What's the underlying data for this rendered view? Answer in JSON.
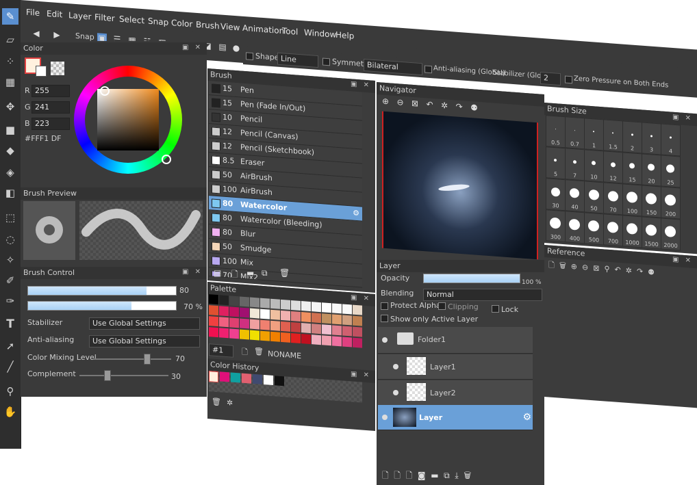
{
  "menu": [
    "File",
    "Edit",
    "Layer",
    "Filter",
    "Select",
    "Snap",
    "Color",
    "Brush",
    "View",
    "Animation",
    "Tool",
    "Window",
    "Help"
  ],
  "toolbar": {
    "snap_label": "Snap"
  },
  "options": {
    "shape_label": "Shape",
    "shape_value": "Line",
    "symmetry_label": "Symmetry",
    "symmetry_value": "Bilateral",
    "antialias_label": "Anti-aliasing (Global)",
    "stabilizer_label": "Stabilizer (Global)",
    "stabilizer_value": "2",
    "zero_pressure_label": "Zero Pressure on Both Ends"
  },
  "color_panel": {
    "title": "Color",
    "r_label": "R",
    "r_value": "255",
    "g_label": "G",
    "g_value": "241",
    "b_label": "B",
    "b_value": "223",
    "hex": "#FFF1 DF",
    "foreground": "#fff1df"
  },
  "brush_preview": {
    "title": "Brush Preview"
  },
  "brush_control": {
    "title": "Brush Control",
    "size_value": "80",
    "opacity_value": "70 %",
    "size_fraction": 0.8,
    "opacity_fraction": 0.7,
    "stabilizer_label": "Stabilizer",
    "stabilizer_value": "Use Global Settings",
    "antialias_label": "Anti-aliasing",
    "antialias_value": "Use Global Settings",
    "mixing_label": "Color Mixing Level",
    "mixing_value": "70",
    "complement_label": "Complement",
    "complement_value": "30"
  },
  "brush_panel": {
    "title": "Brush",
    "items": [
      {
        "size": "15",
        "name": "Pen",
        "color": "#222222"
      },
      {
        "size": "15",
        "name": "Pen (Fade In/Out)",
        "color": "#222222"
      },
      {
        "size": "10",
        "name": "Pencil",
        "color": "#333333"
      },
      {
        "size": "12",
        "name": "Pencil (Canvas)",
        "color": "#cccccc"
      },
      {
        "size": "12",
        "name": "Pencil (Sketchbook)",
        "color": "#cccccc"
      },
      {
        "size": "8.5",
        "name": "Eraser",
        "color": "#ffffff"
      },
      {
        "size": "50",
        "name": "AirBrush",
        "color": "#cccccc"
      },
      {
        "size": "100",
        "name": "AirBrush",
        "color": "#cccccc"
      },
      {
        "size": "80",
        "name": "Watercolor",
        "color": "#7ec8f0"
      },
      {
        "size": "80",
        "name": "Watercolor (Bleeding)",
        "color": "#7ec8f0"
      },
      {
        "size": "80",
        "name": "Blur",
        "color": "#f0b0f0"
      },
      {
        "size": "50",
        "name": "Smudge",
        "color": "#f5d6b8"
      },
      {
        "size": "100",
        "name": "Mix",
        "color": "#b8a8f0"
      },
      {
        "size": "70",
        "name": "Mix2",
        "color": "#b8a8f0"
      }
    ]
  },
  "palette_panel": {
    "title": "Palette",
    "select_value": "#1",
    "name": "NONAME"
  },
  "color_history": {
    "title": "Color History"
  },
  "navigator": {
    "title": "Navigator"
  },
  "layer_panel": {
    "title": "Layer",
    "opacity_label": "Opacity",
    "opacity_value": "100 %",
    "blending_label": "Blending",
    "blending_value": "Normal",
    "protect_alpha": "Protect Alpha",
    "clipping": "Clipping",
    "lock": "Lock",
    "show_active": "Show only Active Layer",
    "layers": [
      {
        "name": "Folder1"
      },
      {
        "name": "Layer1"
      },
      {
        "name": "Layer2"
      },
      {
        "name": "Layer"
      }
    ]
  },
  "brush_size_panel": {
    "title": "Brush Size",
    "sizes": [
      "0.5",
      "0.7",
      "1",
      "1.5",
      "2",
      "3",
      "4",
      "5",
      "7",
      "10",
      "12",
      "15",
      "20",
      "25",
      "30",
      "40",
      "50",
      "70",
      "100",
      "150",
      "200",
      "300",
      "400",
      "500",
      "700",
      "1000",
      "1500",
      "2000"
    ]
  },
  "reference_panel": {
    "title": "Reference"
  }
}
